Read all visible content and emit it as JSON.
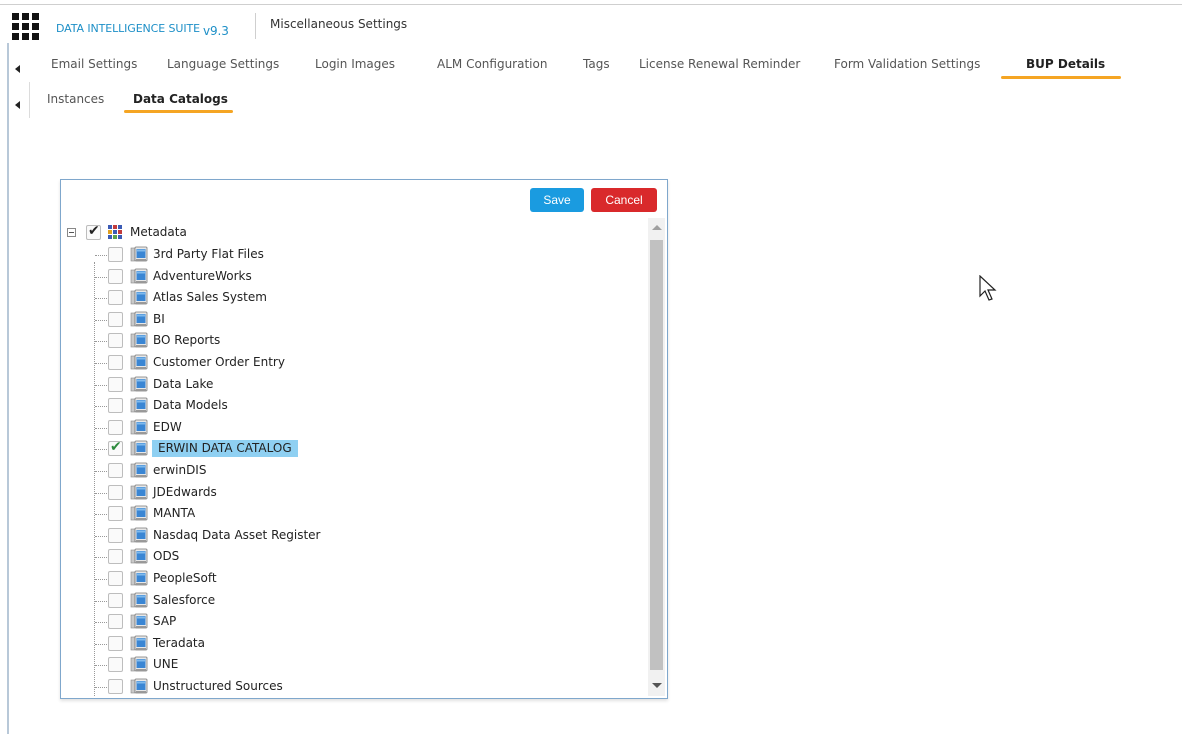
{
  "header": {
    "suite_name": "DATA INTELLIGENCE SUITE",
    "version": "v9.3",
    "page_title": "Miscellaneous Settings"
  },
  "tabs": [
    {
      "label": "Email Settings",
      "active": false
    },
    {
      "label": "Language Settings",
      "active": false
    },
    {
      "label": "Login Images",
      "active": false
    },
    {
      "label": "ALM Configuration",
      "active": false
    },
    {
      "label": "Tags",
      "active": false
    },
    {
      "label": "License Renewal Reminder",
      "active": false
    },
    {
      "label": "Form Validation Settings",
      "active": false
    },
    {
      "label": "BUP Details",
      "active": true
    }
  ],
  "subtabs": [
    {
      "label": "Instances",
      "active": false
    },
    {
      "label": "Data Catalogs",
      "active": true
    }
  ],
  "panel": {
    "save_label": "Save",
    "cancel_label": "Cancel"
  },
  "tree": {
    "root": {
      "label": "Metadata",
      "checked": true,
      "expanded": true,
      "icon": "metadata-cube-icon"
    },
    "items": [
      {
        "label": "3rd Party Flat Files",
        "checked": false,
        "selected": false
      },
      {
        "label": "AdventureWorks",
        "checked": false,
        "selected": false
      },
      {
        "label": "Atlas Sales System",
        "checked": false,
        "selected": false
      },
      {
        "label": "BI",
        "checked": false,
        "selected": false
      },
      {
        "label": "BO Reports",
        "checked": false,
        "selected": false
      },
      {
        "label": "Customer Order Entry",
        "checked": false,
        "selected": false
      },
      {
        "label": "Data Lake",
        "checked": false,
        "selected": false
      },
      {
        "label": "Data Models",
        "checked": false,
        "selected": false
      },
      {
        "label": "EDW",
        "checked": false,
        "selected": false
      },
      {
        "label": "ERWIN DATA CATALOG",
        "checked": true,
        "selected": true
      },
      {
        "label": "erwinDIS",
        "checked": false,
        "selected": false
      },
      {
        "label": "JDEdwards",
        "checked": false,
        "selected": false
      },
      {
        "label": "MANTA",
        "checked": false,
        "selected": false
      },
      {
        "label": "Nasdaq Data Asset Register",
        "checked": false,
        "selected": false
      },
      {
        "label": "ODS",
        "checked": false,
        "selected": false
      },
      {
        "label": "PeopleSoft",
        "checked": false,
        "selected": false
      },
      {
        "label": "Salesforce",
        "checked": false,
        "selected": false
      },
      {
        "label": "SAP",
        "checked": false,
        "selected": false
      },
      {
        "label": "Teradata",
        "checked": false,
        "selected": false
      },
      {
        "label": "UNE",
        "checked": false,
        "selected": false
      },
      {
        "label": "Unstructured Sources",
        "checked": false,
        "selected": false
      }
    ]
  },
  "colors": {
    "accent_underline": "#f5a523",
    "suite_text": "#1d8fc7",
    "save_button": "#1a9be0",
    "cancel_button": "#d9292b",
    "selection": "#8fd0f2",
    "check_green": "#2e8b3e"
  }
}
